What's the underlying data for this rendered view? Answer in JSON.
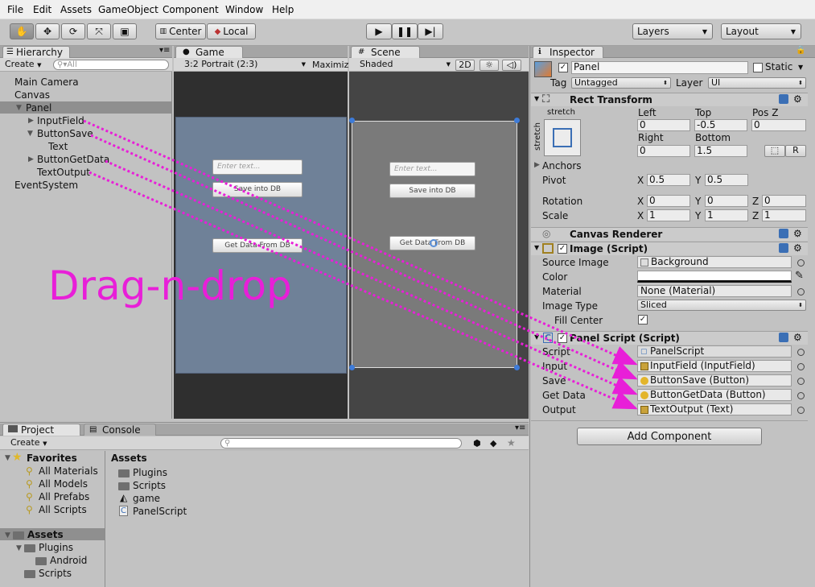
{
  "menu": [
    "File",
    "Edit",
    "Assets",
    "GameObject",
    "Component",
    "Window",
    "Help"
  ],
  "toolbar": {
    "center": "Center",
    "local": "Local",
    "layers": "Layers",
    "layout": "Layout"
  },
  "hierarchy": {
    "tab": "Hierarchy",
    "create": "Create",
    "search": "All",
    "items": [
      "Main Camera",
      "Canvas",
      "Panel",
      "InputField",
      "ButtonSave",
      "Text",
      "ButtonGetData",
      "TextOutput",
      "EventSystem"
    ]
  },
  "game": {
    "tab": "Game",
    "aspect": "3:2 Portrait (2:3)",
    "maximize": "Maximiz",
    "input_placeholder": "Enter text...",
    "save_btn": "Save into DB",
    "get_btn": "Get Data From DB"
  },
  "scene": {
    "tab": "Scene",
    "shading": "Shaded",
    "mode2d": "2D"
  },
  "overlay": "Drag-n-drop",
  "inspector": {
    "tab": "Inspector",
    "name": "Panel",
    "static": "Static",
    "tag_label": "Tag",
    "tag": "Untagged",
    "layer_label": "Layer",
    "layer": "UI",
    "rect": {
      "title": "Rect Transform",
      "stretch": "stretch",
      "left_l": "Left",
      "top_l": "Top",
      "posz_l": "Pos Z",
      "left": "0",
      "top": "-0.5",
      "posz": "0",
      "right_l": "Right",
      "bottom_l": "Bottom",
      "right": "0",
      "bottom": "1.5",
      "r_btn": "R",
      "anchors": "Anchors",
      "pivot": "Pivot",
      "pivot_x": "0.5",
      "pivot_y": "0.5",
      "rotation": "Rotation",
      "rot_x": "0",
      "rot_y": "0",
      "rot_z": "0",
      "scale": "Scale",
      "sc_x": "1",
      "sc_y": "1",
      "sc_z": "1",
      "x": "X",
      "y": "Y",
      "z": "Z"
    },
    "canvas_renderer": "Canvas Renderer",
    "image": {
      "title": "Image (Script)",
      "source_l": "Source Image",
      "source": "Background",
      "color_l": "Color",
      "material_l": "Material",
      "material": "None (Material)",
      "type_l": "Image Type",
      "type": "Sliced",
      "fill_l": "Fill Center"
    },
    "panel_script": {
      "title": "Panel Script (Script)",
      "script_l": "Script",
      "script": "PanelScript",
      "input_l": "Input",
      "input": "InputField (InputField)",
      "save_l": "Save",
      "save": "ButtonSave (Button)",
      "get_l": "Get Data",
      "get": "ButtonGetData (Button)",
      "output_l": "Output",
      "output": "TextOutput (Text)"
    },
    "add_component": "Add Component"
  },
  "project": {
    "tab": "Project",
    "console_tab": "Console",
    "create": "Create",
    "favorites": "Favorites",
    "fav_items": [
      "All Materials",
      "All Models",
      "All Prefabs",
      "All Scripts"
    ],
    "assets": "Assets",
    "tree": [
      "Plugins",
      "Android",
      "Scripts"
    ],
    "assets_header": "Assets",
    "asset_items": [
      "Plugins",
      "Scripts",
      "game",
      "PanelScript"
    ]
  }
}
